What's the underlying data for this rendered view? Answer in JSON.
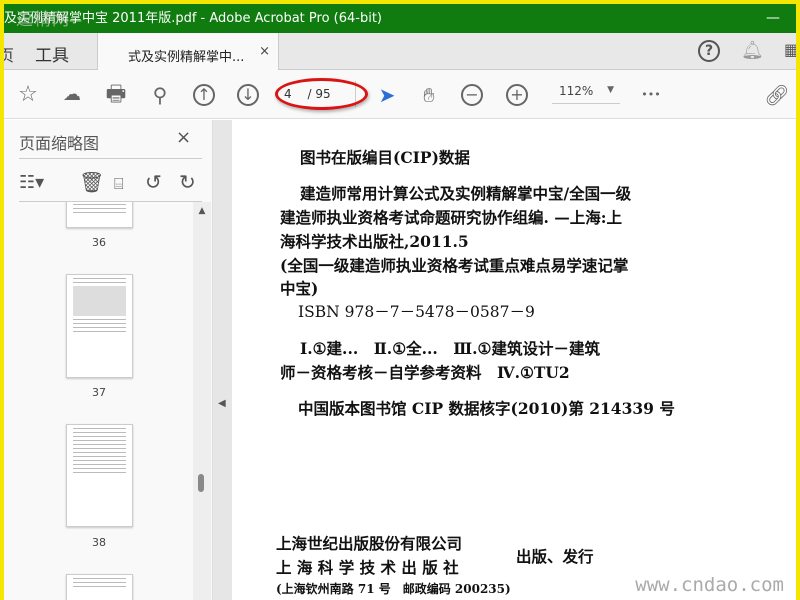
{
  "window": {
    "title": "及实例精解掌中宝 2011年版.pdf - Adobe Acrobat Pro (64-bit)",
    "minimize": "—",
    "watermark": "逗精网"
  },
  "tabs": {
    "home": "页",
    "tools": "工具",
    "doc": "式及实例精解掌中...",
    "close": "×"
  },
  "toolbar": {
    "page_current": "4",
    "page_total": "/ 95",
    "zoom": "112%",
    "more": "•••"
  },
  "panel": {
    "title": "页面缩略图",
    "close": "×",
    "thumbnails": [
      {
        "label": "36"
      },
      {
        "label": "37"
      },
      {
        "label": "38"
      }
    ]
  },
  "document": {
    "title": "图书在版编目(CIP)数据",
    "lines": [
      "建造师常用计算公式及实例精解掌中宝/全国一级",
      "建造师执业资格考试命题研究协作组编. —上海:上",
      "海科学技术出版社,2011.5",
      "(全国一级建造师执业资格考试重点难点易学速记掌",
      "中宝)",
      "ISBN 978－7－5478－0587－9",
      "Ⅰ.①建...　Ⅱ.①全...　Ⅲ.①建筑设计－建筑",
      "师－资格考核－自学参考资料　Ⅳ.①TU2",
      "中国版本图书馆 CIP 数据核字(2010)第 214339 号"
    ],
    "publisher1": "上海世纪出版股份有限公司",
    "publisher2": "上 海 科 学 技 术 出 版 社",
    "publish_note": "出版、发行",
    "address": "(上海钦州南路 71 号　邮政编码 200235)"
  },
  "watermark_url": "www.cndao.com"
}
